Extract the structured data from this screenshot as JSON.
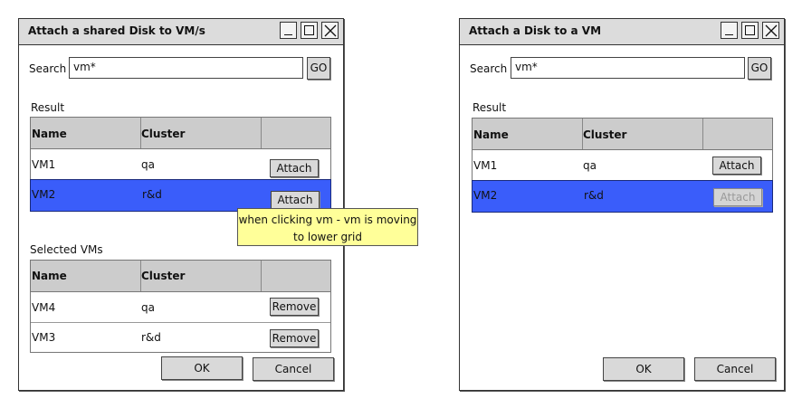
{
  "left_window": {
    "title": "Attach a shared Disk to VM/s",
    "search_label": "Search",
    "search_value": "vm*",
    "go_label": "GO",
    "result_label": "Result",
    "result_columns": [
      "Name",
      "Cluster",
      ""
    ],
    "result_rows": [
      {
        "name": "VM1",
        "cluster": "qa",
        "action": "Attach",
        "selected": false
      },
      {
        "name": "VM2",
        "cluster": "r&d",
        "action": "Attach",
        "selected": true
      }
    ],
    "selected_label": "Selected VMs",
    "selected_columns": [
      "Name",
      "Cluster",
      ""
    ],
    "selected_rows": [
      {
        "name": "VM4",
        "cluster": "qa",
        "action": "Remove"
      },
      {
        "name": "VM3",
        "cluster": "r&d",
        "action": "Remove"
      }
    ],
    "ok_label": "OK",
    "cancel_label": "Cancel"
  },
  "note": "when clicking vm - vm is moving to lower grid",
  "right_window": {
    "title": "Attach a Disk to a VM",
    "search_label": "Search",
    "search_value": "vm*",
    "go_label": "GO",
    "result_label": "Result",
    "result_columns": [
      "Name",
      "Cluster",
      ""
    ],
    "result_rows": [
      {
        "name": "VM1",
        "cluster": "qa",
        "action": "Attach",
        "selected": false,
        "disabled": false
      },
      {
        "name": "VM2",
        "cluster": "r&d",
        "action": "Attach",
        "selected": true,
        "disabled": true
      }
    ],
    "ok_label": "OK",
    "cancel_label": "Cancel"
  },
  "colors": {
    "selection": "#3a5dfa",
    "header": "#cccccc",
    "titlebar": "#dcdcdc",
    "note": "#ffff99"
  }
}
